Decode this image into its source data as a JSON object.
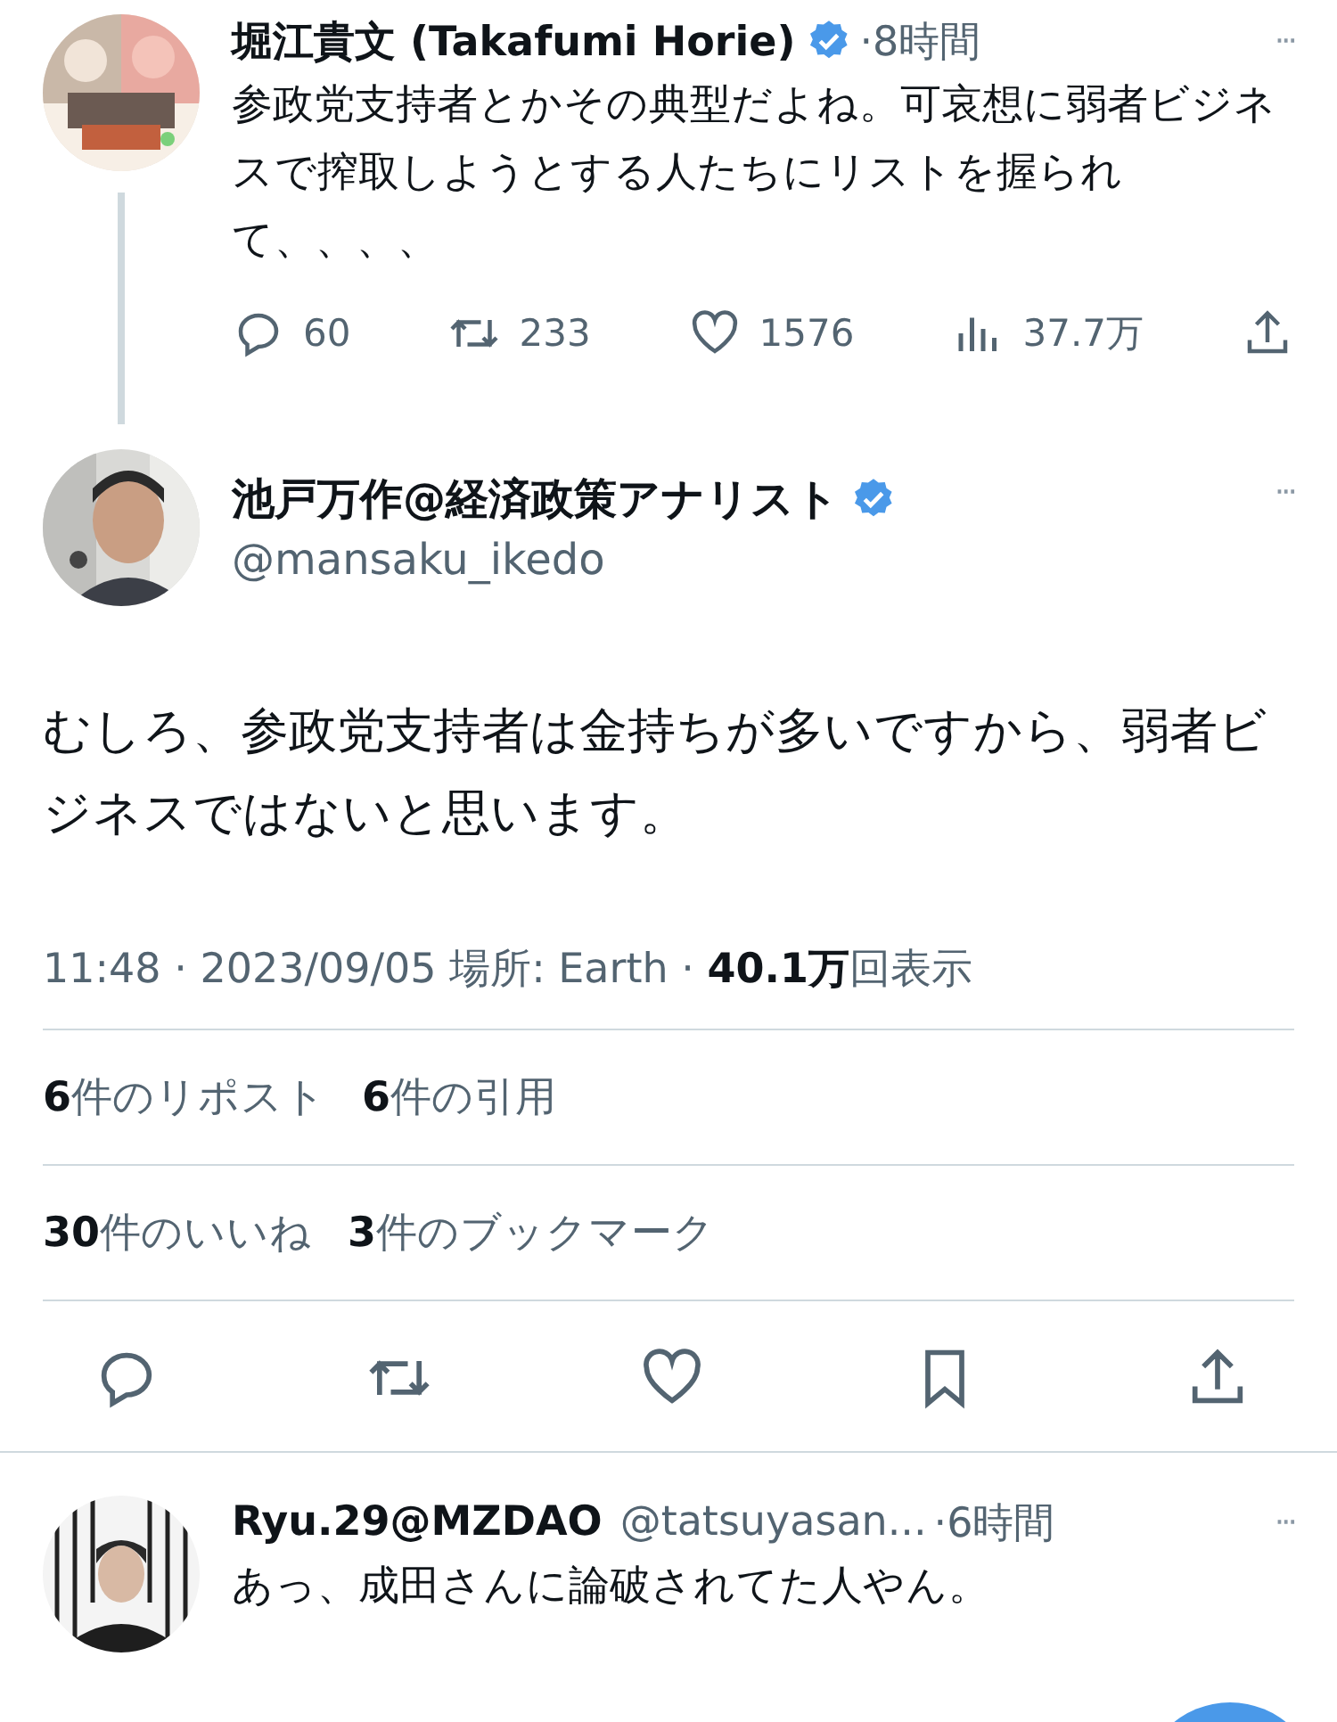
{
  "parent_tweet": {
    "name": "堀江貴文 (Takafumi Horie)",
    "verified": true,
    "time": "·8時間",
    "more": "···",
    "text": "参政党支持者とかその典型だよね。可哀想に弱者ビジネスで搾取しようとする人たちにリストを握られて、、、、",
    "actions": [
      {
        "kind": "reply",
        "count": "60"
      },
      {
        "kind": "repost",
        "count": "233"
      },
      {
        "kind": "like",
        "count": "1576"
      },
      {
        "kind": "views",
        "count": "37.7万"
      },
      {
        "kind": "share"
      }
    ]
  },
  "main_tweet": {
    "name": "池戸万作@経済政策アナリスト",
    "verified": true,
    "handle": "@mansaku_ikedo",
    "more": "···",
    "text": "むしろ、参政党支持者は金持ちが多いですから、弱者ビジネスではないと思います。",
    "meta": "11:48 · 2023/09/05 場所: Earth · ",
    "views_count": "40.1万",
    "views_label": "回表示",
    "stats": [
      [
        {
          "count": "6",
          "label": "件のリポスト"
        },
        {
          "count": "6",
          "label": "件の引用"
        }
      ],
      [
        {
          "count": "30",
          "label": "件のいいね"
        },
        {
          "count": "3",
          "label": "件のブックマーク"
        }
      ]
    ],
    "actions": [
      {
        "kind": "reply"
      },
      {
        "kind": "repost"
      },
      {
        "kind": "like"
      },
      {
        "kind": "bookmark"
      },
      {
        "kind": "share"
      }
    ]
  },
  "reply": {
    "name": "Ryu.29@MZDAO",
    "handle": "@tatsuyasan...",
    "time": "·6時間",
    "more": "···",
    "text": "あっ、成田さんに論破されてた人やん。"
  }
}
